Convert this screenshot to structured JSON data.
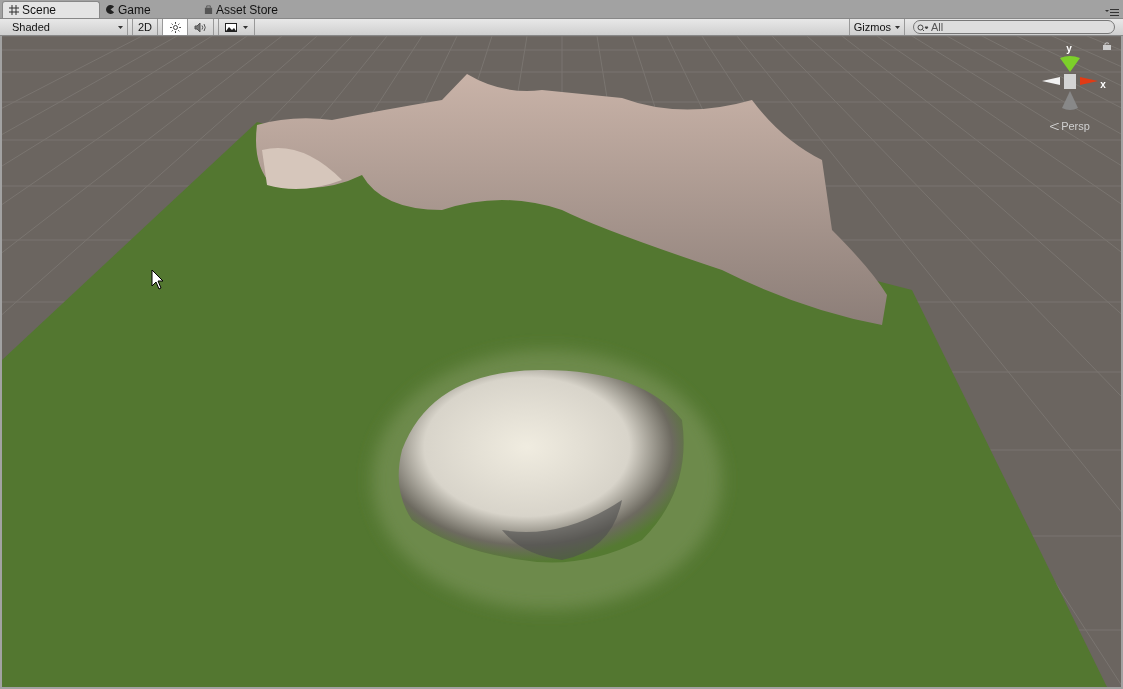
{
  "tabs": [
    {
      "label": "Scene",
      "kind": "grid",
      "selected": true
    },
    {
      "label": "Game",
      "kind": "pacman",
      "selected": false
    },
    {
      "label": "Asset Store",
      "kind": "bag",
      "selected": false
    }
  ],
  "toolbar": {
    "draw_mode": "Shaded",
    "toggle_2d": {
      "label": "2D",
      "on": false
    },
    "lighting_on": true,
    "audio_on": false,
    "effects_on": false,
    "gizmos": "Gizmos",
    "search": {
      "placeholder": "All"
    }
  },
  "scene_gizmo": {
    "y_label": "y",
    "x_label": "x",
    "projection": "Persp"
  }
}
